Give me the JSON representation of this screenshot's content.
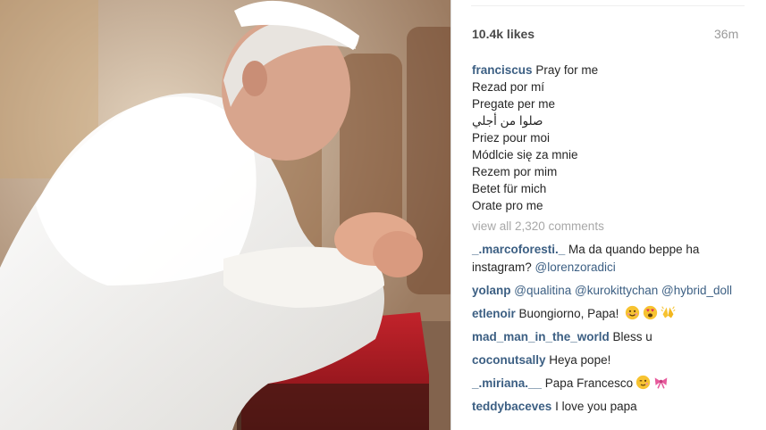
{
  "post": {
    "likes": "10.4k likes",
    "timestamp": "36m"
  },
  "caption": {
    "username": "franciscus",
    "lines": [
      "Pray for me",
      "Rezad por mí",
      "Pregate per me",
      "صلوا من أجلي",
      "Priez pour moi",
      "Módlcie się za mnie",
      "Rezem por mim",
      "Betet für mich",
      "Orate pro me"
    ]
  },
  "view_all": "view all 2,320 comments",
  "comments": [
    {
      "username": "_.marcoforesti._",
      "text": " Ma da quando beppe ha instagram? ",
      "mention": "@lorenzoradici",
      "mention2": ""
    },
    {
      "username": "yolanp",
      "text": " ",
      "mention": "@qualitina",
      "mention2": " @kurokittychan @hybrid_doll"
    },
    {
      "username": "etlenoir",
      "text": " Buongiorno, Papa! ",
      "mention": "",
      "mention2": ""
    },
    {
      "username": "mad_man_in_the_world",
      "text": " Bless u",
      "mention": "",
      "mention2": ""
    },
    {
      "username": "coconutsally",
      "text": " Heya pope!",
      "mention": "",
      "mention2": ""
    },
    {
      "username": "_.miriana.__",
      "text": " Papa Francesco",
      "mention": "",
      "mention2": ""
    },
    {
      "username": "teddybaceves",
      "text": " I love you papa",
      "mention": "",
      "mention2": ""
    }
  ],
  "icons": {
    "comment_3": [
      "smiling-face-emoji",
      "heart-eyes-face-emoji",
      "praying-hands-emoji"
    ],
    "comment_6": [
      "winking-face-emoji",
      "pink-ribbon-emoji"
    ]
  },
  "colors": {
    "username": "#3c5f83",
    "secondary_text": "#9a9a9a",
    "divider": "#dbdbdb"
  }
}
